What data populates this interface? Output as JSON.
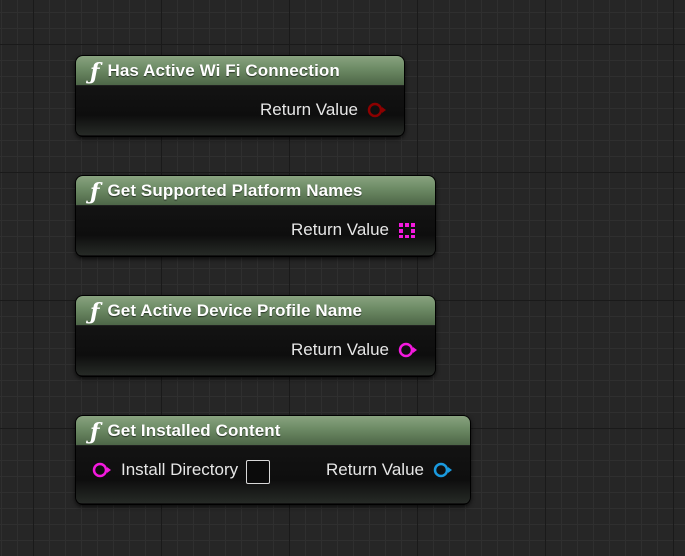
{
  "nodes": [
    {
      "title": "Has Active Wi Fi Connection",
      "outputs": [
        {
          "label": "Return Value",
          "type": "bool",
          "color": "#8c0000"
        }
      ]
    },
    {
      "title": "Get Supported Platform Names",
      "outputs": [
        {
          "label": "Return Value",
          "type": "string-array",
          "color": "#f419de"
        }
      ]
    },
    {
      "title": "Get Active Device Profile Name",
      "outputs": [
        {
          "label": "Return Value",
          "type": "string",
          "color": "#f419de"
        }
      ]
    },
    {
      "title": "Get Installed Content",
      "inputs": [
        {
          "label": "Install Directory",
          "type": "string",
          "color": "#f419de",
          "checked": false
        }
      ],
      "outputs": [
        {
          "label": "Return Value",
          "type": "struct-array",
          "color": "#1a9adf"
        }
      ]
    }
  ],
  "icons": {
    "function": "function-icon",
    "bool_pin": "bool-pin-icon",
    "array_pin": "array-pin-icon",
    "string_pin": "string-pin-icon",
    "object_pin": "object-pin-icon"
  },
  "glyphs": {
    "function": "ƒ"
  }
}
